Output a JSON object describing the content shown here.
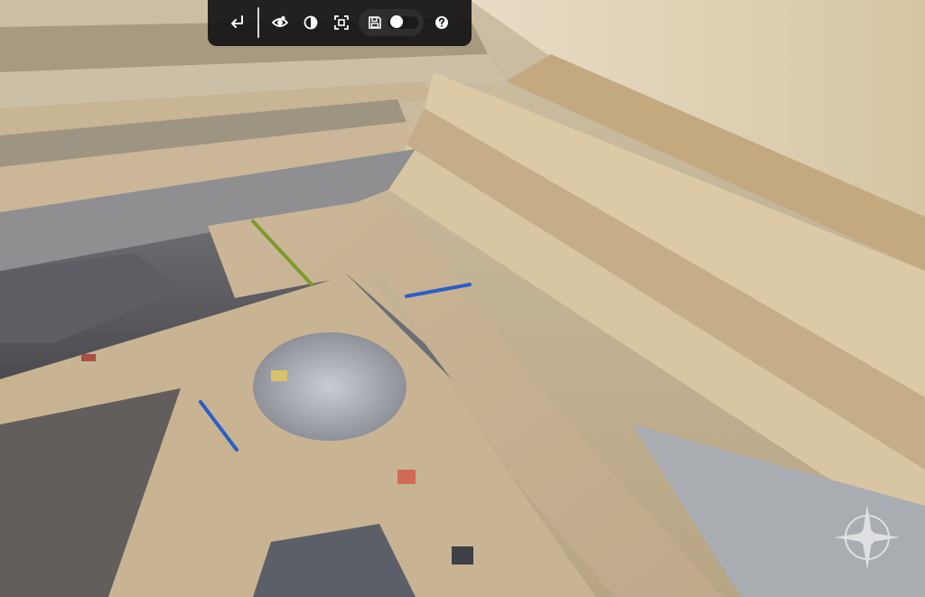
{
  "viewer": {
    "toolbar": {
      "buttons": [
        {
          "name": "back-button",
          "icon": "return-arrow-icon"
        },
        {
          "name": "visibility-button",
          "icon": "eye-icon"
        },
        {
          "name": "contrast-button",
          "icon": "half-circle-icon"
        },
        {
          "name": "focus-button",
          "icon": "focus-frame-icon"
        },
        {
          "name": "save-button",
          "icon": "floppy-disk-icon"
        },
        {
          "name": "help-button",
          "icon": "question-mark-icon"
        }
      ],
      "toggle_on": false
    },
    "scene": {
      "description_icon": "open-pit-mine-3d-model",
      "markers": [
        {
          "color": "#7d9a2a",
          "kind": "green-marker"
        },
        {
          "color": "#2a5fc8",
          "kind": "blue-marker"
        },
        {
          "color": "#2a5fc8",
          "kind": "blue-marker"
        }
      ]
    },
    "compass_icon": "compass-rose-icon"
  }
}
